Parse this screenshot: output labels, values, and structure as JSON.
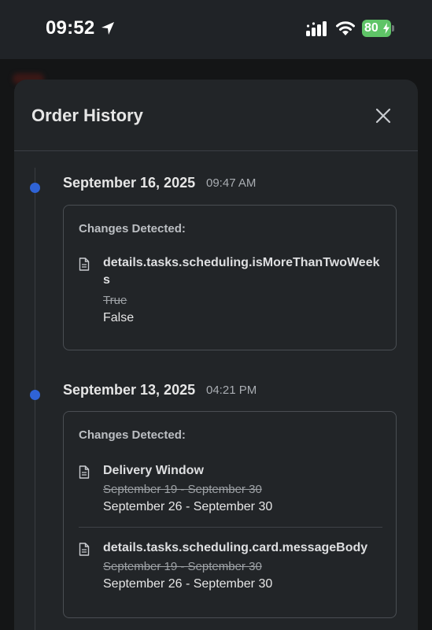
{
  "status_bar": {
    "time": "09:52",
    "battery_percent": "80"
  },
  "sheet": {
    "title": "Order History"
  },
  "entries": [
    {
      "date": "September 16, 2025",
      "time": "09:47 AM",
      "heading": "Changes Detected:",
      "changes": [
        {
          "field": "details.tasks.scheduling.isMoreThanTwoWeeks",
          "old_value": "True",
          "new_value": "False"
        }
      ]
    },
    {
      "date": "September 13, 2025",
      "time": "04:21 PM",
      "heading": "Changes Detected:",
      "changes": [
        {
          "field": "Delivery Window",
          "old_value": "September 19 - September 30",
          "new_value": "September 26 - September 30"
        },
        {
          "field": "details.tasks.scheduling.card.messageBody",
          "old_value": "September 19 - September 30",
          "new_value": "September 26 - September 30"
        }
      ]
    }
  ]
}
